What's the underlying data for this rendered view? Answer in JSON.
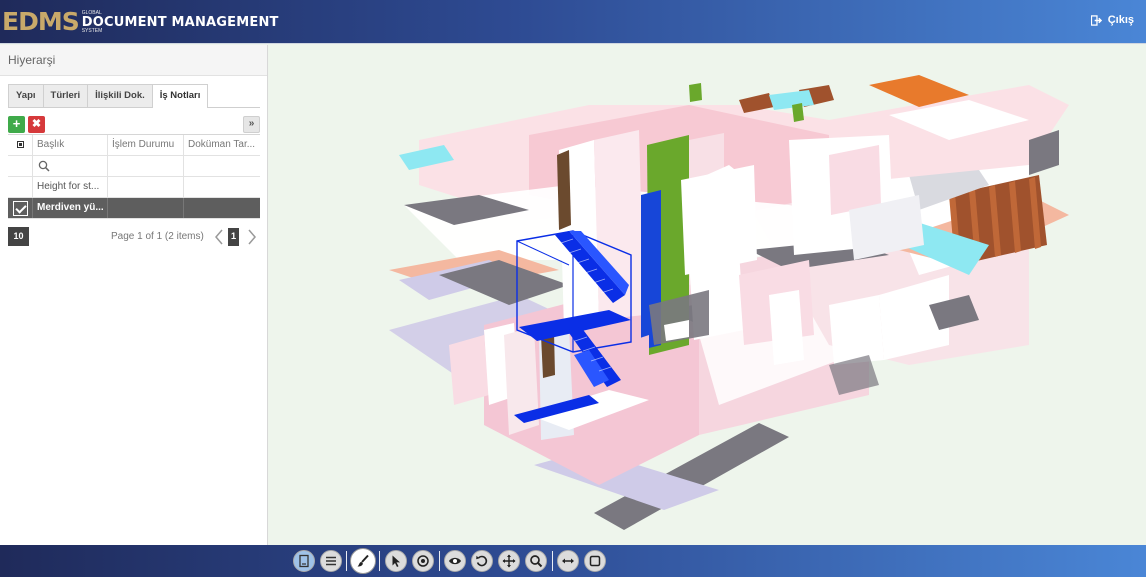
{
  "header": {
    "logo_main": "EDMS",
    "logo_line1": "GLOBAL",
    "logo_line2": "DOCUMENT MANAGEMENT",
    "logo_line3": "SYSTEM",
    "logout_label": "Çıkış"
  },
  "panel": {
    "title": "Hiyerarşi",
    "tabs": [
      {
        "label": "Yapı"
      },
      {
        "label": "Türleri"
      },
      {
        "label": "İlişkili Dok."
      },
      {
        "label": "İş Notları"
      }
    ],
    "active_tab": "İş Notları",
    "toolbar": {
      "add": "+",
      "delete": "✖",
      "expand": "»"
    },
    "grid": {
      "columns": [
        "Başlık",
        "İşlem Durumu",
        "Doküman Tar..."
      ],
      "rows": [
        {
          "title": "Height for st...",
          "status": "",
          "date": "",
          "selected": false
        },
        {
          "title": "Merdiven yü...",
          "status": "",
          "date": "",
          "selected": true
        }
      ]
    },
    "pager": {
      "page_size": "10",
      "info": "Page 1 of 1 (2 items)",
      "current_page": "1"
    }
  },
  "bottom_toolbar": {
    "tools": [
      {
        "icon": "model-browser-icon",
        "state": "selected"
      },
      {
        "icon": "layers-list-icon",
        "state": "normal"
      },
      {
        "icon": "paint-brush-icon",
        "state": "active"
      },
      {
        "icon": "select-pointer-icon",
        "state": "normal"
      },
      {
        "icon": "target-icon",
        "state": "normal"
      },
      {
        "icon": "eye-icon",
        "state": "normal"
      },
      {
        "icon": "rotate-icon",
        "state": "normal"
      },
      {
        "icon": "pan-icon",
        "state": "normal"
      },
      {
        "icon": "zoom-icon",
        "state": "normal"
      },
      {
        "icon": "measure-icon",
        "state": "normal"
      },
      {
        "icon": "section-box-icon",
        "state": "normal"
      }
    ]
  },
  "colors": {
    "header_start": "#1f2a5a",
    "header_end": "#4a86d6",
    "logo_gold": "#c8a96a",
    "stair_highlight": "#0a2ee6",
    "wall_pink": "#f4c6d4",
    "green_panel": "#6aa82c",
    "floor_gray": "#7a7880",
    "orange_accent": "#e87a2c",
    "wood_brown": "#a0522d",
    "glass_cyan": "#8ee8f2"
  }
}
